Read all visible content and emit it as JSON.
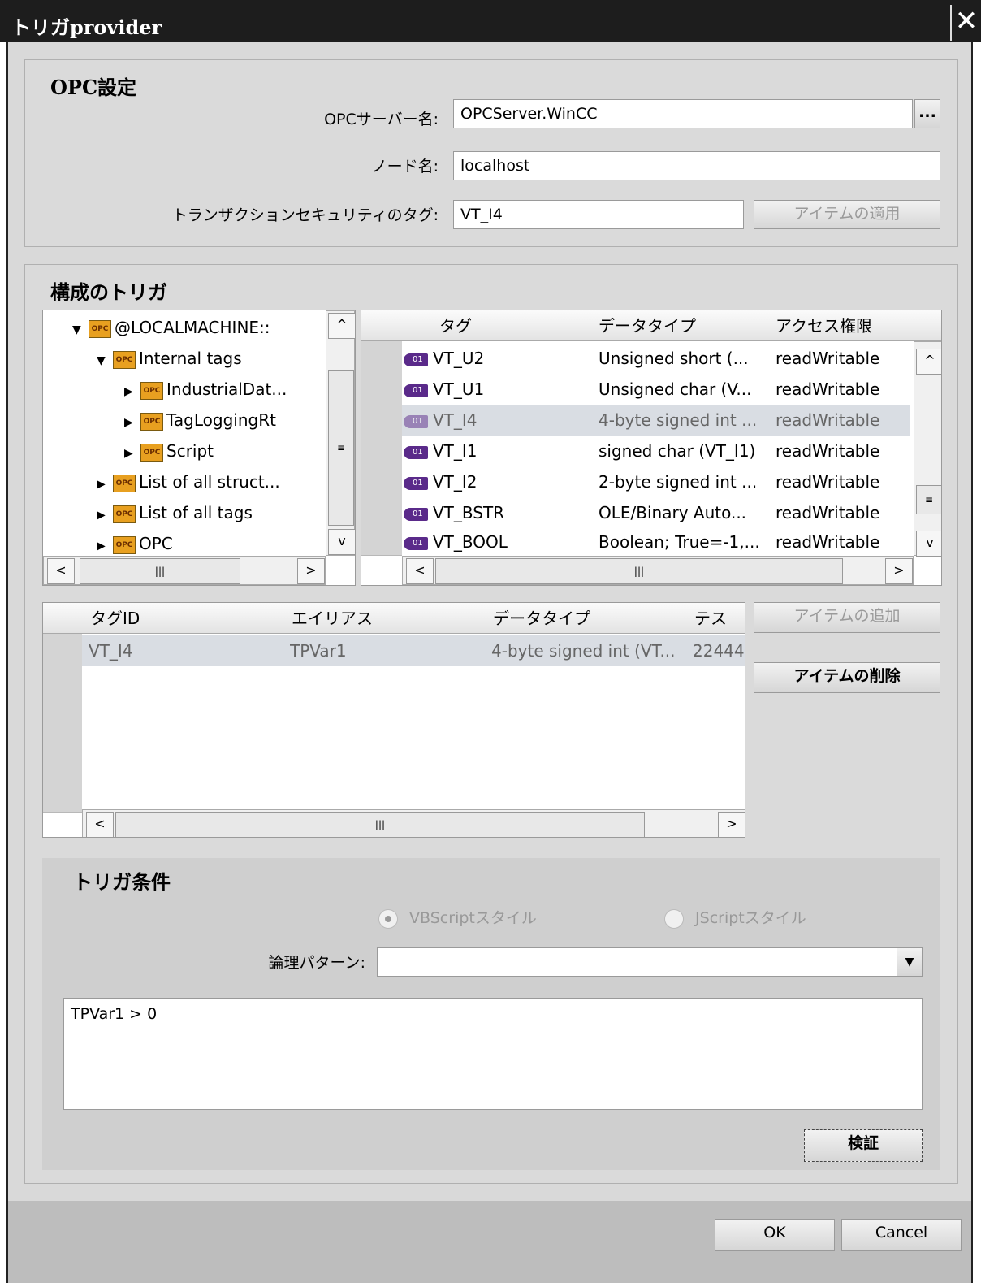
{
  "window": {
    "title": "トリガprovider",
    "close": "✕"
  },
  "opc": {
    "title": "OPC設定",
    "server_label": "OPCサーバー名:",
    "server_value": "OPCServer.WinCC",
    "browse": "...",
    "node_label": "ノード名:",
    "node_value": "localhost",
    "security_label": "トランザクションセキュリティのタグ:",
    "security_value": "VT_I4",
    "apply": "アイテムの適用"
  },
  "config": {
    "title": "構成のトリガ",
    "tree": [
      {
        "label": "@LOCALMACHINE::",
        "arrow": "▼"
      },
      {
        "label": "Internal tags",
        "arrow": "▼"
      },
      {
        "label": "IndustrialDat...",
        "arrow": "▶"
      },
      {
        "label": "TagLoggingRt",
        "arrow": "▶"
      },
      {
        "label": "Script",
        "arrow": "▶"
      },
      {
        "label": "List of all struct...",
        "arrow": "▶"
      },
      {
        "label": "List of all tags",
        "arrow": "▶"
      },
      {
        "label": "OPC",
        "arrow": "▶"
      }
    ],
    "tag_grid": {
      "headers": [
        "タグ",
        "データタイプ",
        "アクセス権限"
      ],
      "rows": [
        [
          "VT_U2",
          "Unsigned short (...",
          "readWritable"
        ],
        [
          "VT_U1",
          "Unsigned char (V...",
          "readWritable"
        ],
        [
          "VT_I4",
          "4-byte signed int ...",
          "readWritable"
        ],
        [
          "VT_I1",
          "signed char (VT_I1)",
          "readWritable"
        ],
        [
          "VT_I2",
          "2-byte signed int ...",
          "readWritable"
        ],
        [
          "VT_BSTR",
          "OLE/Binary Auto...",
          "readWritable"
        ],
        [
          "VT_BOOL",
          "Boolean; True=-1,...",
          "readWritable"
        ]
      ]
    },
    "item_grid": {
      "headers": [
        "タグID",
        "エイリアス",
        "データタイプ",
        "テス"
      ],
      "rows": [
        [
          "VT_I4",
          "TPVar1",
          "4-byte signed int (VT...",
          "22444"
        ]
      ]
    },
    "add": "アイテムの追加",
    "delete": "アイテムの削除"
  },
  "condition": {
    "title": "トリガ条件",
    "vbscript": "VBScriptスタイル",
    "jscript": "JScriptスタイル",
    "pattern_label": "論理パターン:",
    "pattern_value": "",
    "expression": "TPVar1 > 0",
    "verify": "検証"
  },
  "footer": {
    "ok": "OK",
    "cancel": "Cancel"
  },
  "scroll": {
    "grip": "|||",
    "left": "<",
    "right": ">",
    "up": "^",
    "down": "v",
    "mid": "≡"
  }
}
